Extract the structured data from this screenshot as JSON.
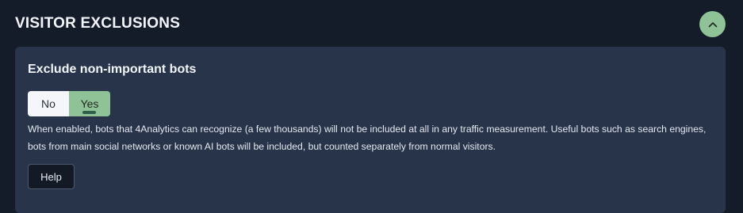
{
  "section": {
    "title": "VISITOR EXCLUSIONS",
    "collapse_icon": "chevron-up-icon"
  },
  "setting": {
    "title": "Exclude non-important bots",
    "toggle": {
      "options": [
        "No",
        "Yes"
      ],
      "selected": "Yes"
    },
    "description": "When enabled, bots that 4Analytics can recognize (a few thousands) will not be included at all in any traffic measurement. Useful bots such as search engines, bots from main social networks or known AI bots will be included, but counted separately from normal visitors.",
    "help_label": "Help"
  },
  "colors": {
    "background": "#141b29",
    "card": "#283449",
    "accent": "#8fc296",
    "indicator": "#2f5f4a"
  }
}
